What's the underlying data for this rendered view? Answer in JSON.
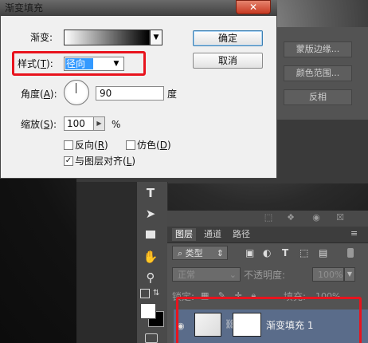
{
  "dialog": {
    "title": "渐变填充",
    "close_label": "✕",
    "gradient_label": "渐变:",
    "style_label_pre": "样式(",
    "style_label_key": "T",
    "style_label_post": "):",
    "style_value": "径向",
    "angle_label_pre": "角度(",
    "angle_label_key": "A",
    "angle_label_post": "):",
    "angle_value": "90",
    "angle_unit": "度",
    "scale_label_pre": "缩放(",
    "scale_label_key": "S",
    "scale_label_post": "):",
    "scale_value": "100",
    "scale_unit": "%",
    "reverse_label_pre": "反向(",
    "reverse_label_key": "R",
    "reverse_label_post": ")",
    "dither_label_pre": "仿色(",
    "dither_label_key": "D",
    "dither_label_post": ")",
    "align_label_pre": "与图层对齐(",
    "align_label_key": "L",
    "align_label_post": ")",
    "align_checked": "✓",
    "ok_label": "确定",
    "cancel_label": "取消"
  },
  "right_panel": {
    "buttons": [
      "蒙版边缘...",
      "颜色范围...",
      "反相"
    ]
  },
  "layers": {
    "tabs": [
      "图层",
      "通道",
      "路径"
    ],
    "filter_label": "类型",
    "blend_mode": "正常",
    "opacity_label": "不透明度:",
    "opacity_value": "100%",
    "lock_label": "锁定:",
    "fill_label": "填充:",
    "fill_value": "100%",
    "layer_name": "渐变填充 1"
  },
  "colors": {
    "highlight_red": "#e8141e",
    "selection_blue": "#3399ff",
    "layer_selected": "#5a6c8a"
  }
}
